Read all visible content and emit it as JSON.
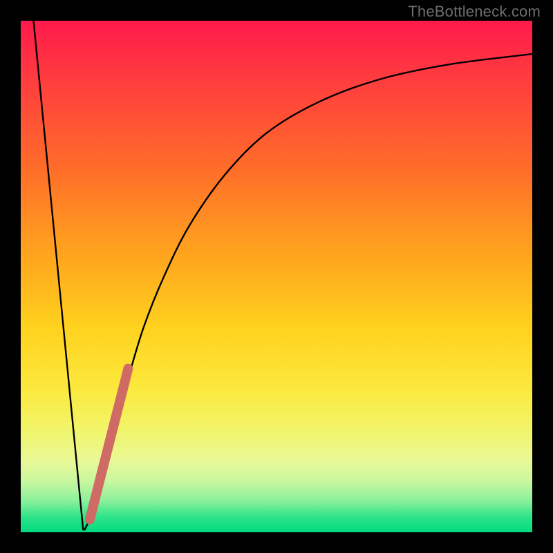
{
  "watermark": "TheBottleneck.com",
  "chart_data": {
    "type": "line",
    "title": "",
    "xlabel": "",
    "ylabel": "",
    "xlim": [
      0,
      100
    ],
    "ylim": [
      0,
      100
    ],
    "series": [
      {
        "name": "bottleneck-curve-left",
        "x": [
          2.5,
          12.2
        ],
        "values": [
          100,
          0.5
        ]
      },
      {
        "name": "bottleneck-curve-right",
        "x": [
          12.5,
          15,
          17,
          19,
          21,
          24,
          28,
          33,
          40,
          48,
          58,
          70,
          84,
          100
        ],
        "values": [
          0.5,
          6,
          14,
          22,
          30,
          40,
          50,
          60,
          70,
          78,
          84,
          88.5,
          91.5,
          93.5
        ]
      },
      {
        "name": "highlight-segment",
        "style": "thick",
        "x": [
          13.5,
          21.0
        ],
        "values": [
          2.5,
          32
        ]
      }
    ],
    "colors": {
      "curve": "#000000",
      "highlight": "#cf6a65"
    }
  }
}
